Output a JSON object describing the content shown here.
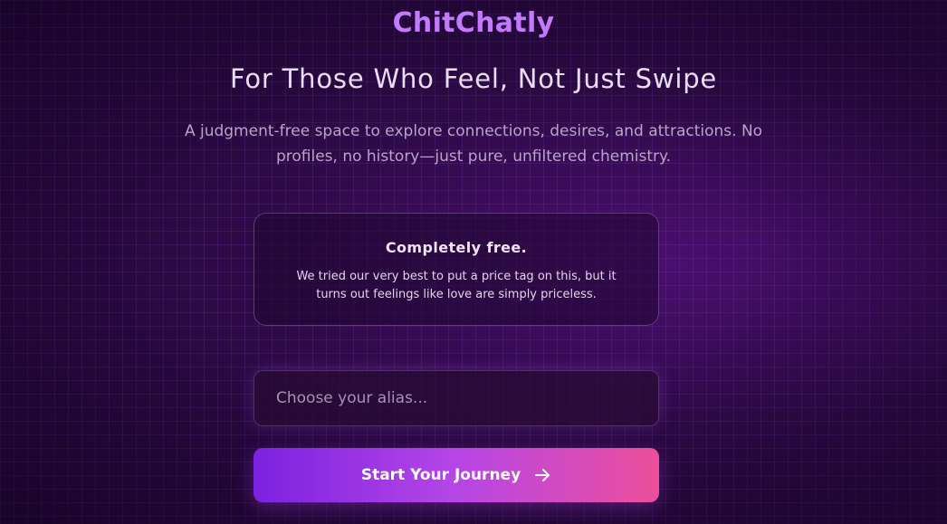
{
  "brand": {
    "name": "ChitChatly"
  },
  "hero": {
    "headline": "For Those Who Feel, Not Just Swipe",
    "subtitle": "A judgment-free space to explore connections, desires, and attractions. No profiles, no history—just pure, unfiltered chemistry."
  },
  "pricing_card": {
    "title": "Completely free.",
    "text": "We tried our very best to put a price tag on this, but it turns out feelings like love are simply priceless."
  },
  "alias_field": {
    "placeholder": "Choose your alias...",
    "value": ""
  },
  "start_button": {
    "label": "Start Your Journey",
    "icon": "arrow-right-icon"
  },
  "colors": {
    "brand_accent": "#c27aff",
    "button_gradient_start": "#7b22e0",
    "button_gradient_end": "#ec4f9a",
    "background": "#2e0a47"
  }
}
